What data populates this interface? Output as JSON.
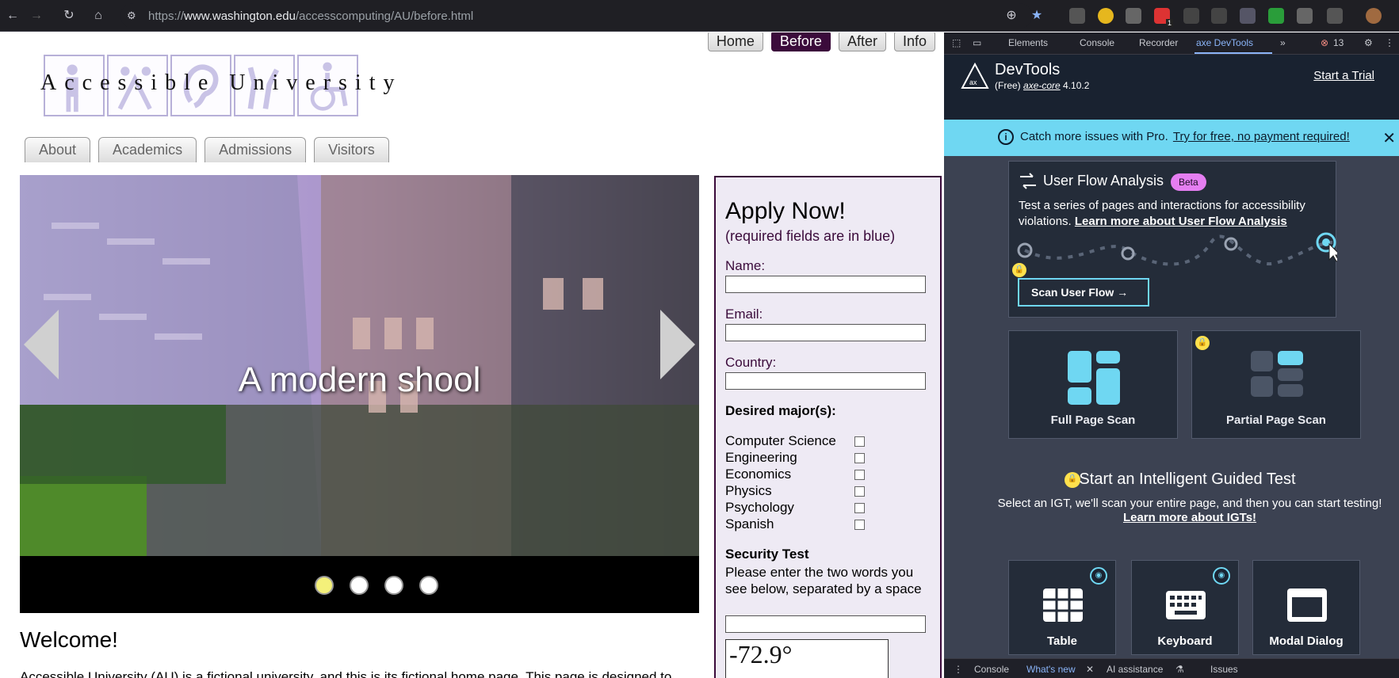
{
  "browser": {
    "url_scheme": "https://",
    "url_host": "www.washington.edu",
    "url_path": "/accesscomputing/AU/before.html",
    "nav": [
      "back-icon",
      "forward-icon",
      "reload-icon",
      "home-icon"
    ],
    "notification_badge": "1"
  },
  "site": {
    "topnav": [
      "Home",
      "Before",
      "After",
      "Info"
    ],
    "active_topnav": "Before",
    "logo_text": "Accessible University",
    "tabs": [
      "About",
      "Academics",
      "Admissions",
      "Visitors"
    ],
    "slide_caption": "A modern shool",
    "slide_count": 4,
    "active_slide": 1,
    "welcome": "Welcome!",
    "intro": "Accessible University (AU) is a fictional university, and this is its fictional home page. This page is designed to"
  },
  "form": {
    "title": "Apply Now!",
    "subtitle": "(required fields are in blue)",
    "name_label": "Name:",
    "email_label": "Email:",
    "country_label": "Country:",
    "majors_heading": "Desired major(s):",
    "majors": [
      "Computer Science",
      "Engineering",
      "Economics",
      "Physics",
      "Psychology",
      "Spanish"
    ],
    "security_heading": "Security Test",
    "security_text": "Please enter the two words you see below, separated by a space",
    "captcha_text": "-72.9°"
  },
  "devtools": {
    "tabs": [
      "Elements",
      "Console",
      "Recorder",
      "axe DevTools"
    ],
    "active_tab": "axe DevTools",
    "error_count": "13",
    "product": "DevTools",
    "free_label": "(Free)",
    "core": "axe-core",
    "core_version": "4.10.2",
    "start_trial": "Start a Trial",
    "promo_text": "Catch more issues with Pro.",
    "promo_link": "Try for free, no payment required!",
    "flow_title": "User Flow Analysis",
    "flow_badge": "Beta",
    "flow_desc": "Test a series of pages and interactions for accessibility violations.",
    "flow_link": "Learn more about User Flow Analysis",
    "flow_button": "Scan User Flow",
    "full_scan": "Full Page Scan",
    "partial_scan": "Partial Page Scan",
    "igt_title": "Start an Intelligent Guided Test",
    "igt_desc": "Select an IGT, we'll scan your entire page, and then you can start testing!",
    "igt_link": "Learn more about IGTs!",
    "igt_cards": [
      "Table",
      "Keyboard",
      "Modal Dialog"
    ],
    "bottom_tabs": [
      "Console",
      "What's new",
      "AI assistance",
      "Issues"
    ],
    "active_bottom": "What's new"
  }
}
